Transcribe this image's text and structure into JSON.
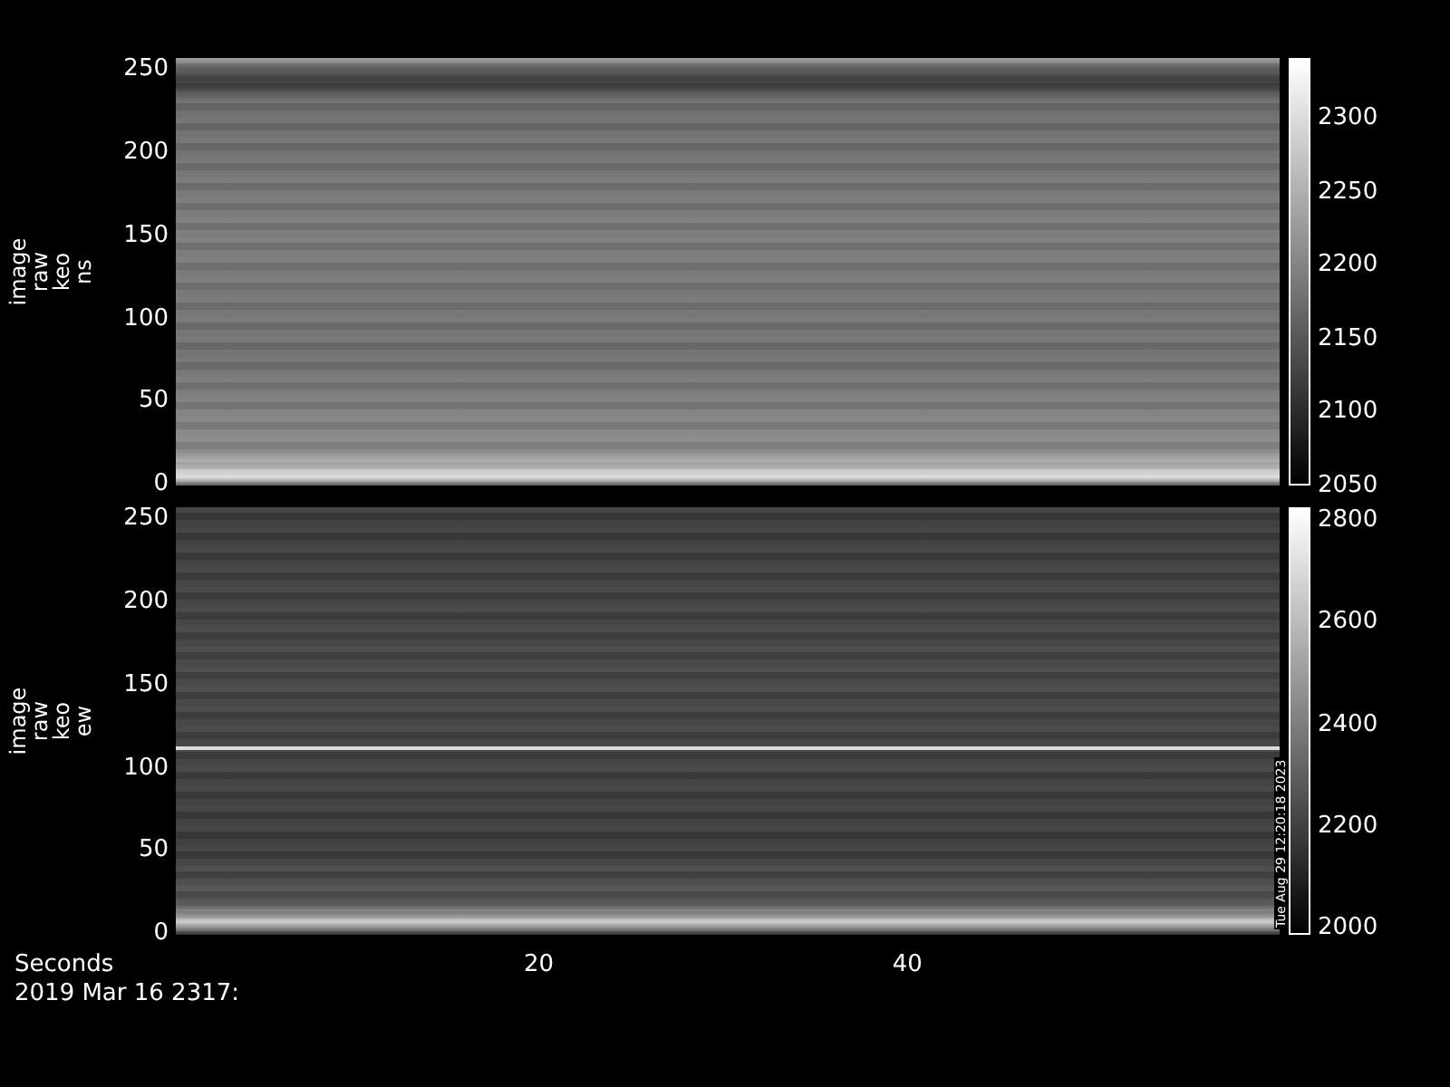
{
  "panels": [
    {
      "ylabel": [
        "image",
        "raw",
        "keo",
        "ns"
      ],
      "yticks": [
        "250",
        "200",
        "150",
        "100",
        "50",
        "0"
      ],
      "colorbar": {
        "ticks": [
          "2300",
          "2250",
          "2200",
          "2150",
          "2100",
          "2050"
        ]
      },
      "bright_line": false
    },
    {
      "ylabel": [
        "image",
        "raw",
        "keo",
        "ew"
      ],
      "yticks": [
        "250",
        "200",
        "150",
        "100",
        "50",
        "0"
      ],
      "colorbar": {
        "ticks": [
          "2800",
          "2600",
          "2400",
          "2200",
          "2000"
        ]
      },
      "bright_line": true,
      "timestamp": "Tue Aug 29 12:20:18 2023"
    }
  ],
  "xaxis": {
    "title": "Seconds",
    "ticks": [
      "20",
      "40"
    ]
  },
  "date": "2019 Mar 16 2317:"
}
